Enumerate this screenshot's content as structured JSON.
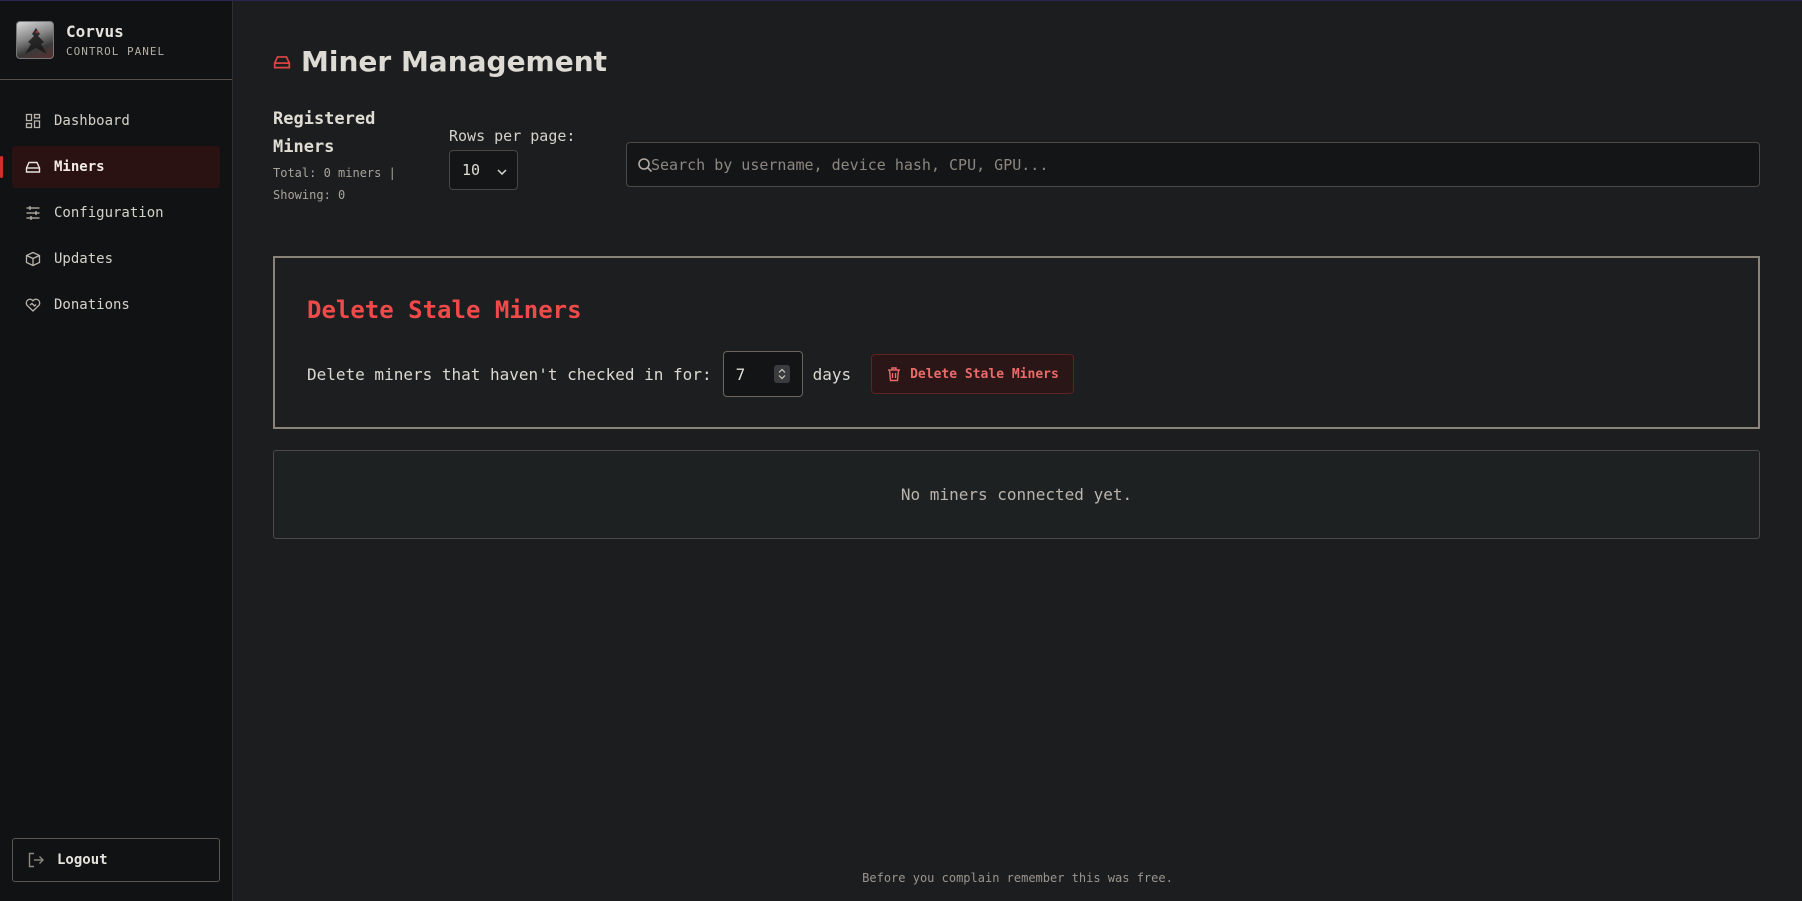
{
  "brand": {
    "name": "Corvus",
    "subtitle": "CONTROL PANEL"
  },
  "sidebar": {
    "items": [
      {
        "label": "Dashboard",
        "icon": "dashboard-icon",
        "active": false
      },
      {
        "label": "Miners",
        "icon": "hard-drive-icon",
        "active": true
      },
      {
        "label": "Configuration",
        "icon": "sliders-icon",
        "active": false
      },
      {
        "label": "Updates",
        "icon": "package-icon",
        "active": false
      },
      {
        "label": "Donations",
        "icon": "heart-handshake-icon",
        "active": false
      }
    ],
    "logout_label": "Logout"
  },
  "page": {
    "title": "Miner Management",
    "title_icon": "hard-drive-icon"
  },
  "registered": {
    "title": "Registered Miners",
    "total_text": "Total: 0 miners |",
    "showing_text": "Showing: 0"
  },
  "pagination": {
    "label": "Rows per page:",
    "selected": "10"
  },
  "search": {
    "placeholder": "Search by username, device hash, CPU, GPU...",
    "value": ""
  },
  "stale": {
    "title": "Delete Stale Miners",
    "prompt": "Delete miners that haven't checked in for:",
    "days_value": "7",
    "days_unit": "days",
    "button_label": "Delete Stale Miners"
  },
  "empty_state": "No miners connected yet.",
  "footer": "Before you complain remember this was free.",
  "colors": {
    "accent": "#ef4a4a",
    "background": "#1c1d1f",
    "sidebar": "#111213",
    "active_nav": "#2a1213"
  }
}
